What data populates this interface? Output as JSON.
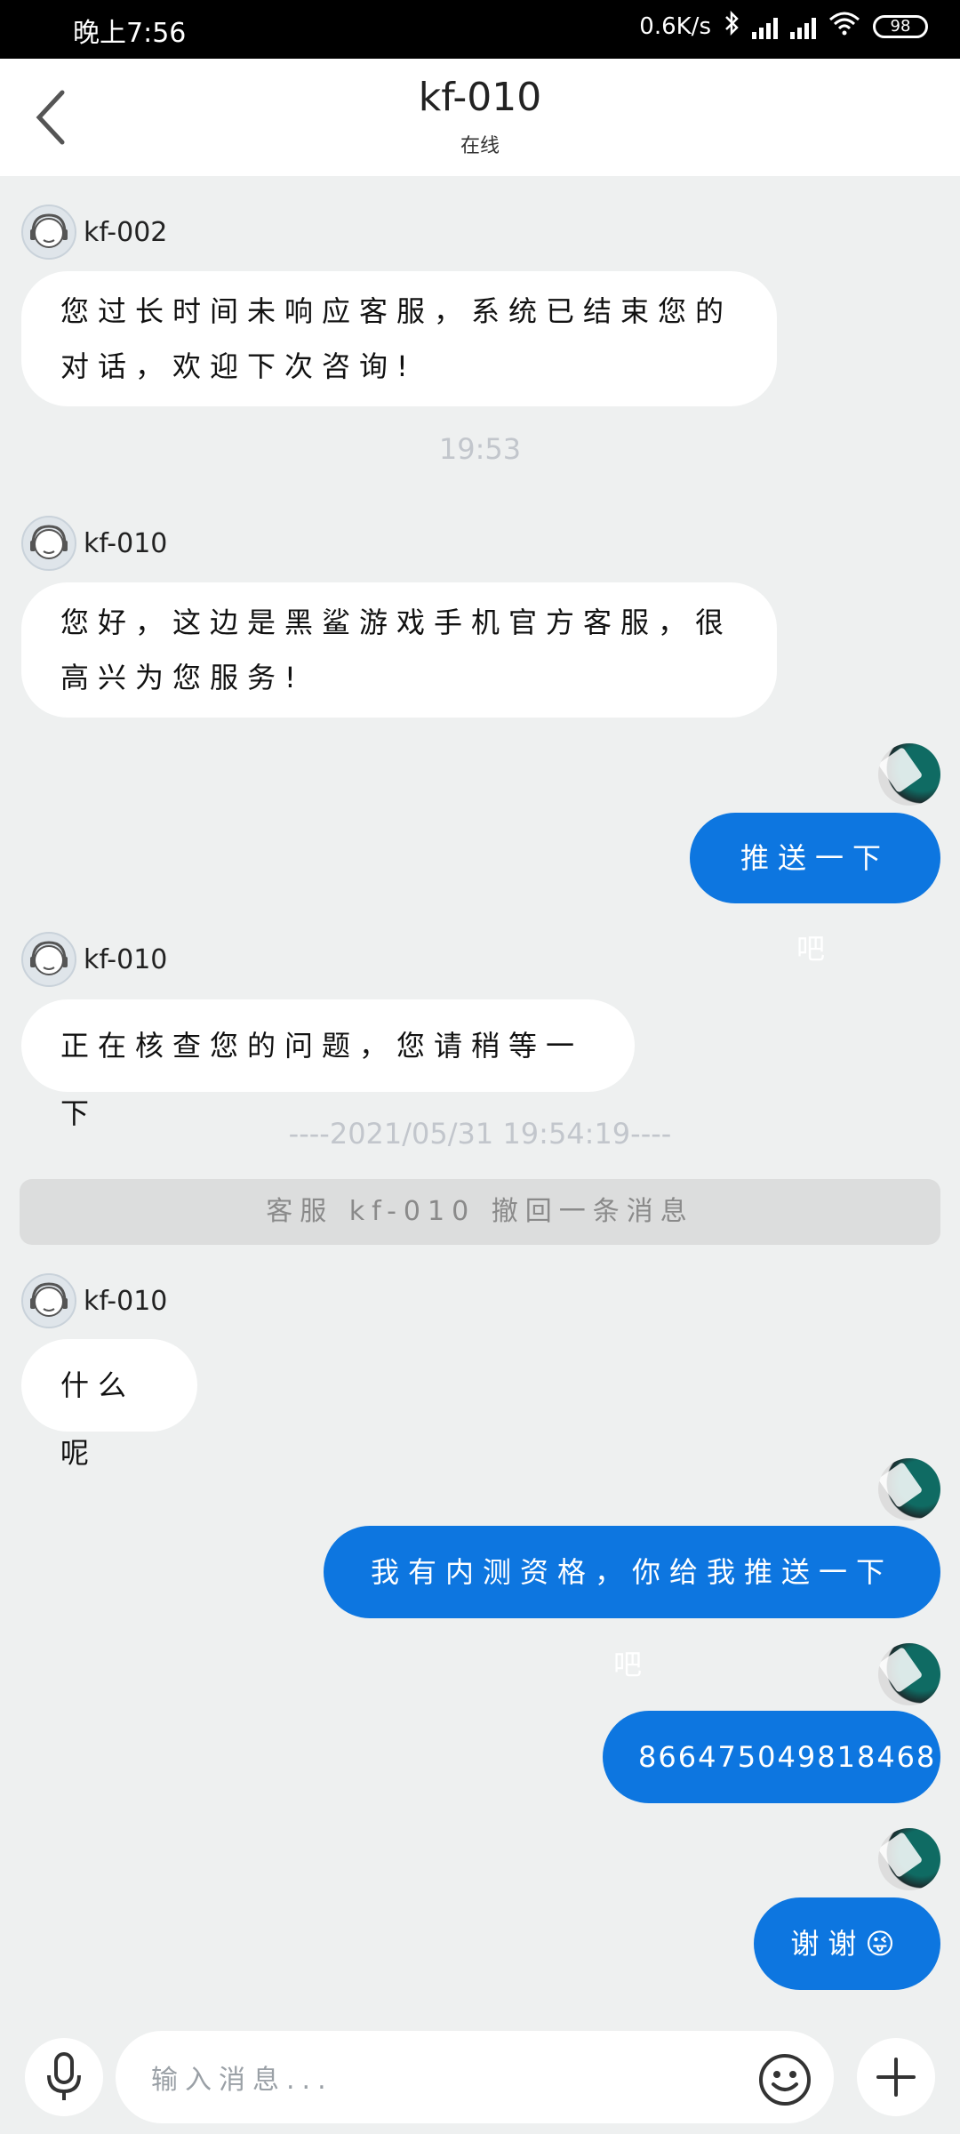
{
  "status_bar": {
    "time": "晚上7:56",
    "speed": "0.6K/s",
    "battery": "98"
  },
  "header": {
    "title": "kf-010",
    "subtitle": "在线"
  },
  "messages": {
    "m1": {
      "sender": "kf-002",
      "text": "您过长时间未响应客服，系统已结束您的对话，欢迎下次咨询!"
    },
    "t1": "19:53",
    "m2": {
      "sender": "kf-010",
      "text": "您好，这边是黑鲨游戏手机官方客服，很高兴为您服务!"
    },
    "u1": "推送一下吧",
    "m3": {
      "sender": "kf-010",
      "text": "正在核查您的问题，您请稍等一下"
    },
    "t2": "----2021/05/31 19:54:19----",
    "recall": "客服 kf-010 撤回一条消息",
    "m4": {
      "sender": "kf-010",
      "text": "什么呢"
    },
    "u2": "我有内测资格，你给我推送一下吧",
    "u3": "866475049818468",
    "u4": "谢谢😜"
  },
  "input": {
    "placeholder": "输入消息..."
  },
  "colors": {
    "accent": "#0d76e0",
    "background": "#eef0f0"
  },
  "icons": [
    "back-arrow-icon",
    "bluetooth-icon",
    "signal-icon",
    "wifi-icon",
    "battery-icon",
    "agent-avatar-icon",
    "microphone-icon",
    "emoji-icon",
    "plus-icon"
  ]
}
